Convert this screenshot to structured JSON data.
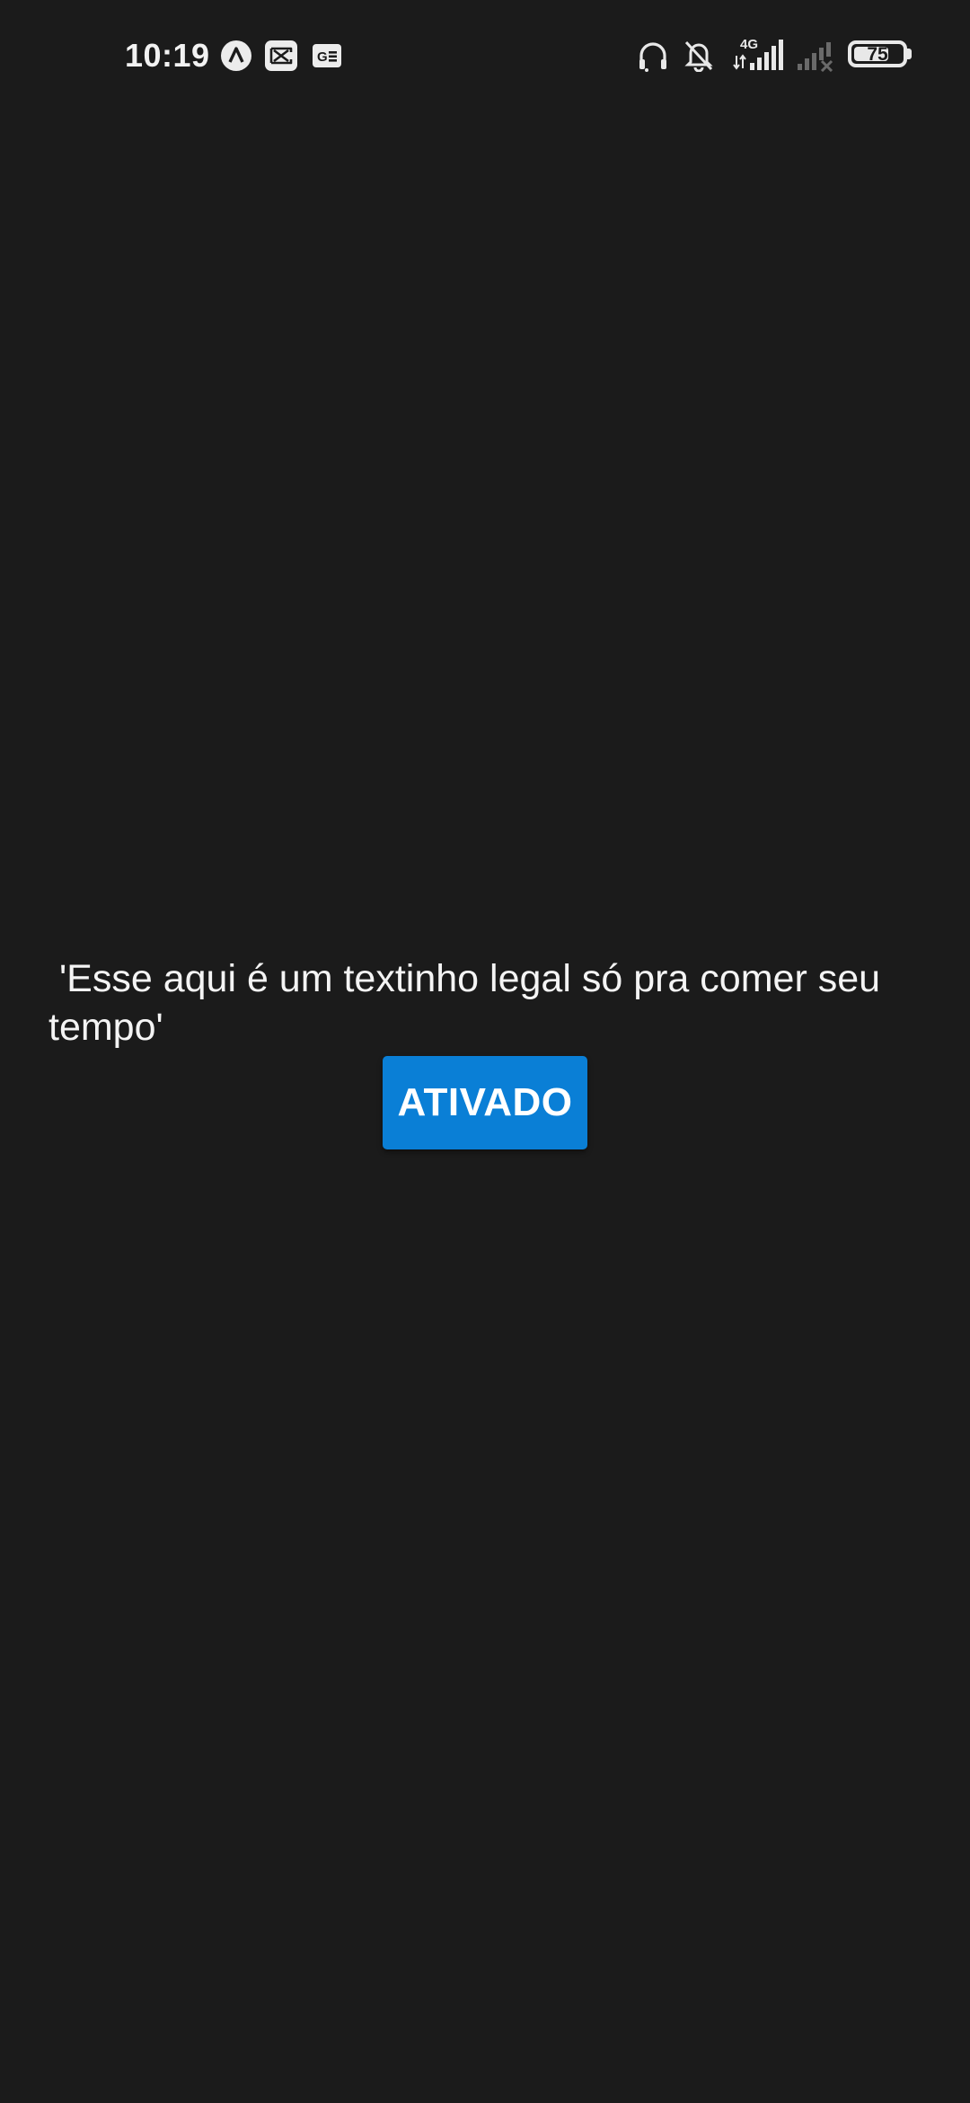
{
  "status_bar": {
    "time": "10:19",
    "network_type": "4G",
    "battery_level": "75",
    "left_icons": [
      "nova-launcher-icon",
      "capcut-icon",
      "gboard-icon"
    ],
    "right_icons": [
      "headphones-icon",
      "bell-muted-icon",
      "signal-4g-icon",
      "signal-no-service-icon",
      "battery-icon"
    ]
  },
  "main": {
    "message": " 'Esse aqui é um textinho legal só pra comer seu tempo'",
    "button_label": "ATIVADO"
  },
  "colors": {
    "background": "#1b1b1b",
    "button": "#0a7fd6",
    "text": "#ffffff"
  }
}
